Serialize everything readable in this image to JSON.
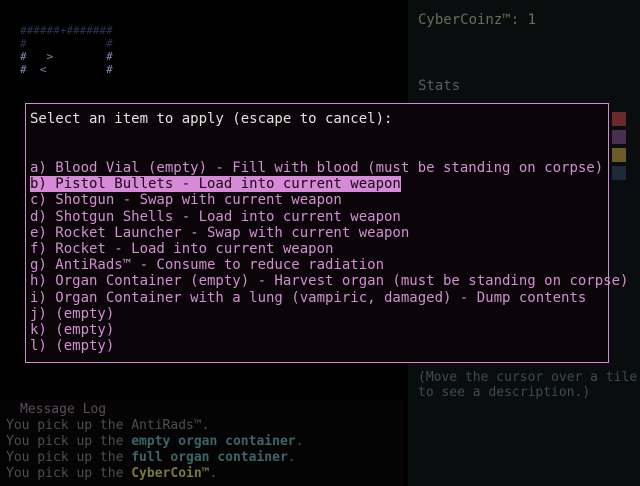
{
  "map": {
    "frame_rows": [
      "######+#######",
      "#            #",
      "#   >        #",
      "#  <         #"
    ]
  },
  "sidebar": {
    "coinz_label": "CyberCoinz™: 1",
    "stats_title": "Stats",
    "description": "(Move the cursor over a tile to see a description.)",
    "bar_colors": [
      "#6b2a2a",
      "#4a3050",
      "#6e5a24",
      "#1c2a3a"
    ]
  },
  "message_log": {
    "title": "Message Log",
    "lines": [
      {
        "prefix": "You pick up the ",
        "item": "AntiRads™.",
        "style": "normal"
      },
      {
        "prefix": "You pick up the ",
        "item": "empty organ container",
        "suffix": ".",
        "style": "hl"
      },
      {
        "prefix": "You pick up the ",
        "item": "full organ container",
        "suffix": ".",
        "style": "hl"
      },
      {
        "prefix": "You pick up the ",
        "item": "CyberCoin™",
        "suffix": ".",
        "style": "gold"
      }
    ]
  },
  "modal": {
    "prompt": "Select an item to apply (escape to cancel):",
    "items": [
      "a) Blood Vial (empty) - Fill with blood (must be standing on corpse)",
      "b) Pistol Bullets - Load into current weapon",
      "c) Shotgun - Swap with current weapon",
      "d) Shotgun Shells - Load into current weapon",
      "e) Rocket Launcher - Swap with current weapon",
      "f) Rocket - Load into current weapon",
      "g) AntiRads™ - Consume to reduce radiation",
      "h) Organ Container (empty) - Harvest organ (must be standing on corpse)",
      "i) Organ Container with a lung (vampiric, damaged) - Dump contents",
      "j) (empty)",
      "k) (empty)",
      "l) (empty)"
    ],
    "selected_index": 1,
    "accent_color": "#d28cd6"
  }
}
